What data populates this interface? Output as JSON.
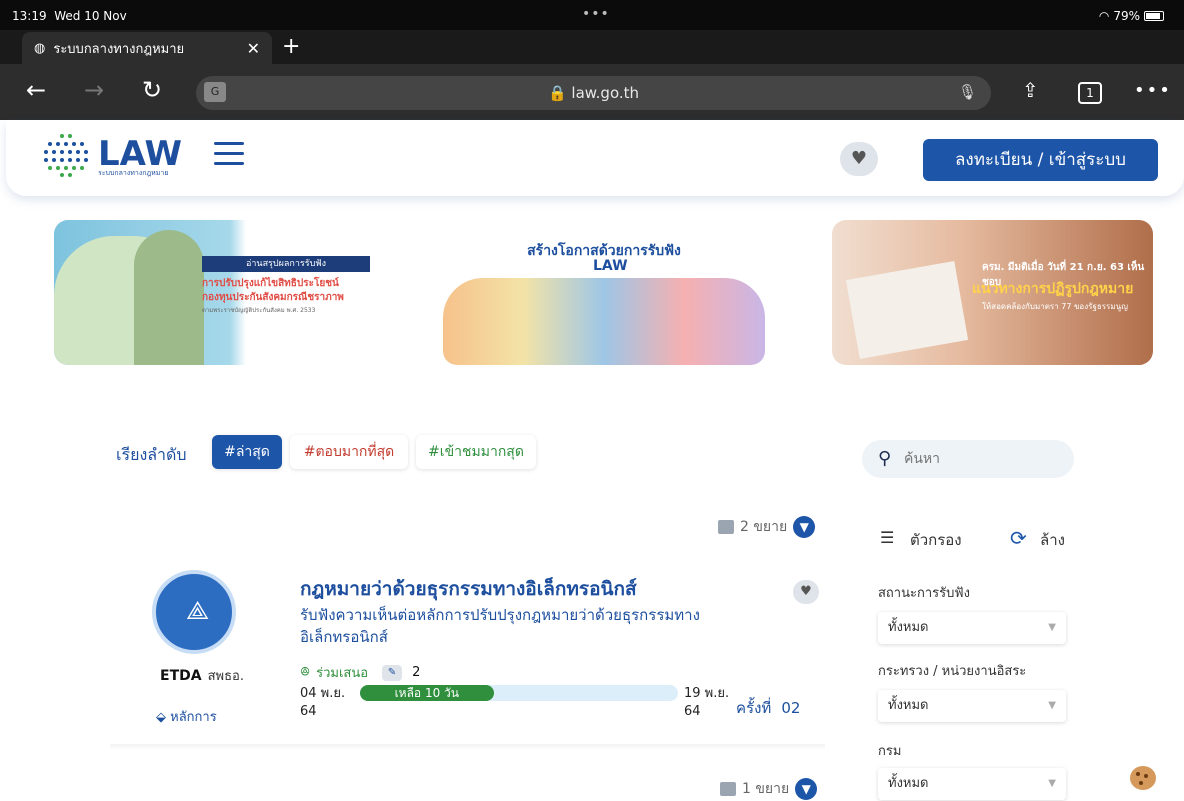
{
  "status": {
    "time": "13:19",
    "date": "Wed 10 Nov",
    "battery": "79%"
  },
  "browser": {
    "tab_title": "ระบบกลางทางกฎหมาย",
    "url": "law.go.th",
    "tab_count": "1"
  },
  "site": {
    "logo": "LAW",
    "logo_sub": "ระบบกลางทางกฎหมาย",
    "register_label": "ลงทะเบียน / เข้าสู่ระบบ"
  },
  "banners": [
    {
      "title_bar": "อ่านสรุปผลการรับฟัง",
      "line1": "การปรับปรุงแก้ไขสิทธิประโยชน์",
      "line2": "กองทุนประกันสังคมกรณีชราภาพ",
      "line3": "ตามพระราชบัญญัติประกันสังคม พ.ศ. 2533"
    },
    {
      "head": "สร้างโอกาสด้วยการรับฟัง",
      "head2": "LAW"
    },
    {
      "ttl1": "ครม. มีมติเมื่อ วันที่ 21 ก.ย. 63 เห็นชอบ",
      "ttl2": "แนวทางการปฏิรูปกฎหมาย",
      "ttl3": "ให้สอดคล้องกับมาตรา 77 ของรัฐธรรมนูญ"
    }
  ],
  "sort": {
    "label": "เรียงลำดับ",
    "chips": [
      "#ล่าสุด",
      "#ตอบมากที่สุด",
      "#เข้าชมมากสุด"
    ]
  },
  "search": {
    "placeholder": "ค้นหา"
  },
  "list": {
    "expand_top": "2 ขยาย",
    "expand_bottom": "1 ขยาย",
    "card": {
      "org_code": "ETDA",
      "org_name": "สพธอ.",
      "tag": "หลักการ",
      "title": "กฎหมายว่าด้วยธุรกรรมทางอิเล็กทรอนิกส์",
      "desc": "รับฟังความเห็นต่อหลักการปรับปรุงกฎหมายว่าด้วยธุรกรรมทาง อิเล็กทรอนิกส์",
      "participate": "ร่วมเสนอ",
      "count": "2",
      "start_date_1": "04 พ.ย.",
      "start_date_2": "64",
      "end_date_1": "19 พ.ย.",
      "end_date_2": "64",
      "remaining": "เหลือ 10 วัน",
      "progress_percent": 42,
      "round_label": "ครั้งที่",
      "round_num": "02"
    }
  },
  "filters": {
    "filter_label": "ตัวกรอง",
    "reset_label": "ล้าง",
    "groups": [
      {
        "label": "สถานะการรับฟัง",
        "value": "ทั้งหมด"
      },
      {
        "label": "กระทรวง / หน่วยงานอิสระ",
        "value": "ทั้งหมด"
      },
      {
        "label": "กรม",
        "value": "ทั้งหมด"
      }
    ]
  },
  "colors": {
    "brand": "#1d55a8",
    "accent_green": "#2f8f3d",
    "accent_red": "#c23b2e"
  }
}
